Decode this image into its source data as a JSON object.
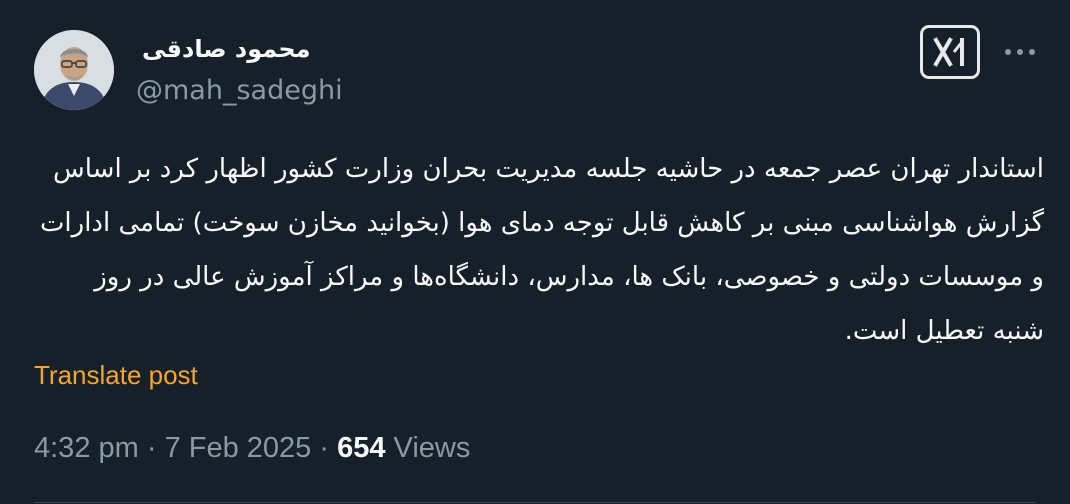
{
  "author": {
    "display_name": "محمود صادقی",
    "handle": "@mah_sadeghi"
  },
  "icons": {
    "grok": "grok-icon",
    "more": "more-icon",
    "avatar": "profile-photo"
  },
  "tweet": {
    "text": "استاندار تهران عصر جمعه در حاشیه جلسه مدیریت بحران وزارت کشور اظهار کرد بر اساس گزارش هواشناسی مبنی بر کاهش قابل توجه دمای هوا (بخوانید مخازن سوخت) تمامی ادارات و موسسات دولتی و خصوصی، بانک ها، مدارس، دانشگاه‌ها و مراکز آموزش عالی در روز شنبه تعطیل است."
  },
  "translate_label": "Translate post",
  "meta": {
    "time": "4:32 pm",
    "sep1": " · ",
    "date": "7 Feb 2025",
    "sep2": " · ",
    "views_count": "654",
    "views_label": " Views"
  },
  "colors": {
    "background": "#15202b",
    "text": "#f7f9f9",
    "muted": "#8b98a5",
    "link": "#f5a623"
  }
}
